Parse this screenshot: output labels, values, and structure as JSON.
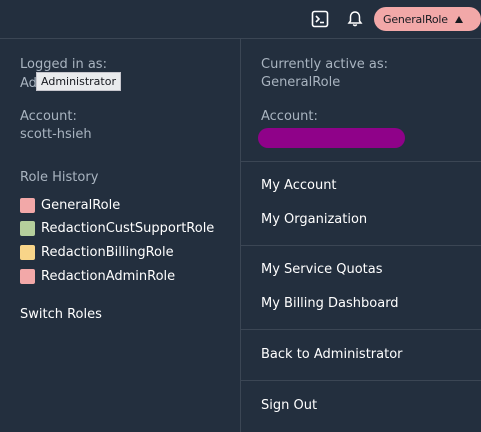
{
  "topbar": {
    "cloudshell_icon": "cloudshell-icon",
    "notifications_icon": "bell-icon",
    "role_label": "GeneralRole"
  },
  "left": {
    "logged_in_label": "Logged in as:",
    "logged_in_value": "Ad",
    "tooltip": "Administrator",
    "account_label": "Account:",
    "account_value": "scott-hsieh",
    "role_history_title": "Role History",
    "role_history": [
      {
        "label": "GeneralRole",
        "color": "#f2a8a8"
      },
      {
        "label": "RedactionCustSupportRole",
        "color": "#b5cf9c"
      },
      {
        "label": "RedactionBillingRole",
        "color": "#f8d589"
      },
      {
        "label": "RedactionAdminRole",
        "color": "#f2a8a8"
      }
    ],
    "switch_roles": "Switch Roles"
  },
  "right": {
    "active_label": "Currently active as:",
    "active_value": "GeneralRole",
    "account_label": "Account:",
    "redaction_color": "#8f0289",
    "menu": {
      "my_account": "My Account",
      "my_organization": "My Organization",
      "service_quotas": "My Service Quotas",
      "billing_dashboard": "My Billing Dashboard",
      "back_to": "Back to Administrator",
      "sign_out": "Sign Out"
    }
  }
}
